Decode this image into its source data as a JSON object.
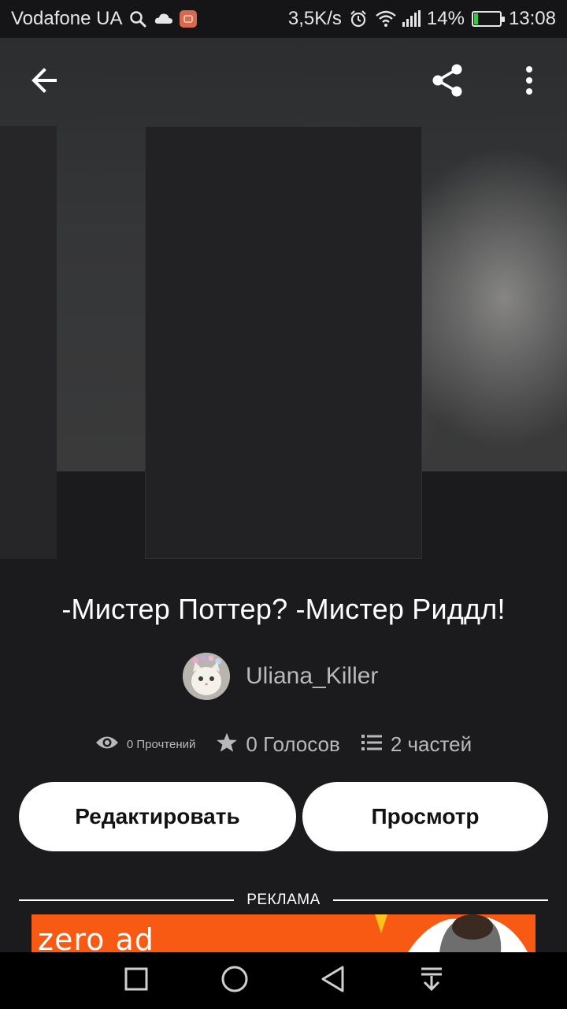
{
  "status_bar": {
    "carrier": "Vodafone UA",
    "speed": "3,5K/s",
    "battery": "14%",
    "battery_level": 0.14,
    "time": "13:08",
    "icons": [
      "search-icon",
      "cloud-icon",
      "app-notification-icon",
      "alarm-icon",
      "wifi-icon",
      "signal-icon",
      "battery-icon"
    ]
  },
  "toolbar": {
    "icons": [
      "back-arrow-icon",
      "share-icon",
      "more-vertical-icon"
    ]
  },
  "story": {
    "title": "-Мистер Поттер? -Мистер Риддл!",
    "author": "Uliana_Killer",
    "reads": "0 Прочтений",
    "votes": "0 Голосов",
    "parts": "2 частей",
    "stat_icons": [
      "eye-icon",
      "star-icon",
      "list-icon"
    ]
  },
  "actions": {
    "edit_label": "Редактировать",
    "view_label": "Просмотр"
  },
  "ad": {
    "label": "РЕКЛАМА",
    "banner_text": "zero ad",
    "banner_color": "#f85a13"
  },
  "nav_bar": {
    "icons": [
      "recent-apps-icon",
      "home-icon",
      "back-icon",
      "notification-pull-icon"
    ]
  }
}
